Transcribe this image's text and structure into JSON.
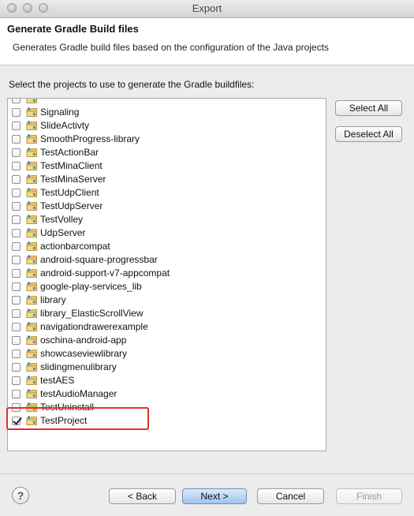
{
  "window": {
    "title": "Export"
  },
  "banner": {
    "title": "Generate Gradle Build files",
    "description": "Generates Gradle build files based on the configuration of the Java projects"
  },
  "projects_label": "Select the projects to use to generate the Gradle buildfiles:",
  "projects": [
    {
      "name": "",
      "checked": false
    },
    {
      "name": "Signaling",
      "checked": false
    },
    {
      "name": "SlideActivty",
      "checked": false
    },
    {
      "name": "SmoothProgress-library",
      "checked": false
    },
    {
      "name": "TestActionBar",
      "checked": false
    },
    {
      "name": "TestMinaClient",
      "checked": false
    },
    {
      "name": "TestMinaServer",
      "checked": false
    },
    {
      "name": "TestUdpClient",
      "checked": false
    },
    {
      "name": "TestUdpServer",
      "checked": false
    },
    {
      "name": "TestVolley",
      "checked": false
    },
    {
      "name": "UdpServer",
      "checked": false
    },
    {
      "name": "actionbarcompat",
      "checked": false
    },
    {
      "name": "android-square-progressbar",
      "checked": false
    },
    {
      "name": "android-support-v7-appcompat",
      "checked": false
    },
    {
      "name": "google-play-services_lib",
      "checked": false
    },
    {
      "name": "library",
      "checked": false
    },
    {
      "name": "library_ElasticScrollView",
      "checked": false
    },
    {
      "name": "navigationdrawerexample",
      "checked": false
    },
    {
      "name": "oschina-android-app",
      "checked": false
    },
    {
      "name": "showcaseviewlibrary",
      "checked": false
    },
    {
      "name": "slidingmenulibrary",
      "checked": false
    },
    {
      "name": "testAES",
      "checked": false
    },
    {
      "name": "testAudioManager",
      "checked": false
    },
    {
      "name": "TestUninstall",
      "checked": false
    },
    {
      "name": "TestProject",
      "checked": true
    }
  ],
  "side_buttons": {
    "select_all": "Select All",
    "deselect_all": "Deselect All"
  },
  "footer": {
    "help": "?",
    "back": "< Back",
    "next": "Next >",
    "cancel": "Cancel",
    "finish": "Finish"
  },
  "colors": {
    "highlight": "#e0312a",
    "primary_button": "#9ec4ec"
  }
}
